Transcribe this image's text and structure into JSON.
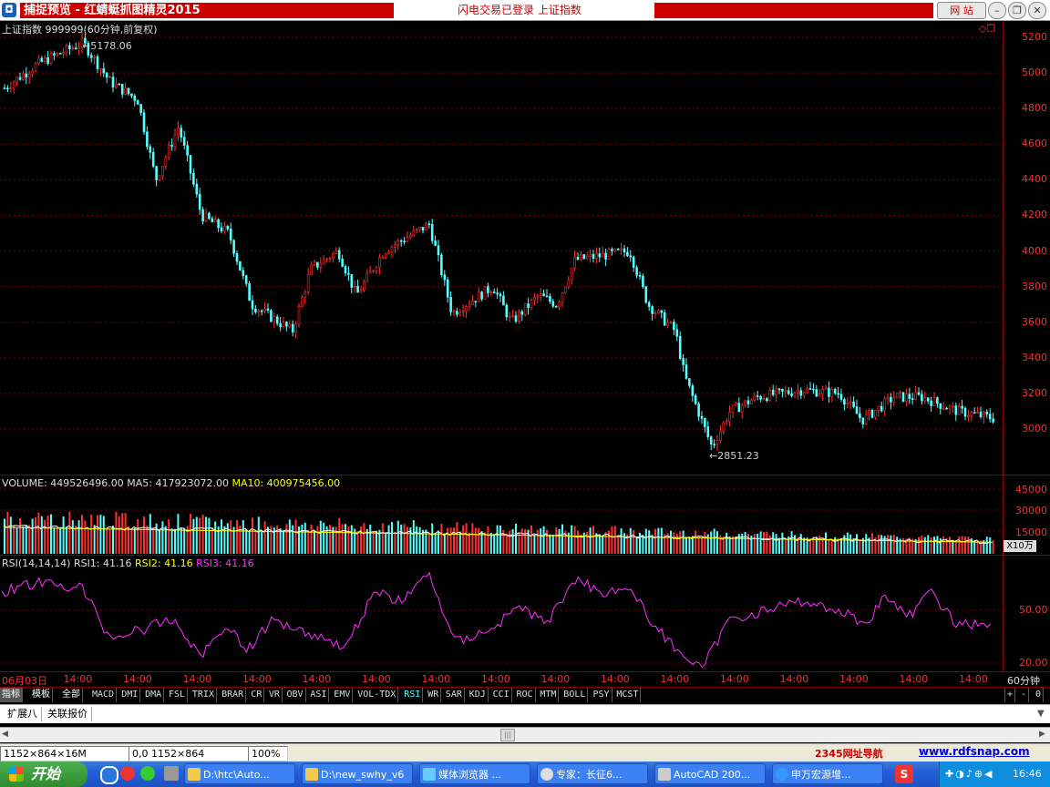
{
  "titlebar": {
    "app_title": "捕捉预览 - 红蜻蜓抓图精灵2015",
    "status_text": "闪电交易已登录   上证指数",
    "website_button": "网 站"
  },
  "main_chart": {
    "header": "上证指数 999999(60分钟,前复权)",
    "high_label": "5178.06",
    "low_label": "2851.23",
    "y_ticks": [
      "5200",
      "5000",
      "4800",
      "4600",
      "4400",
      "4200",
      "4000",
      "3800",
      "3600",
      "3400",
      "3200",
      "3000"
    ]
  },
  "volume_panel": {
    "label": "VOLUME: 449526496.00",
    "ma5_label": "MA5: 417923072.00",
    "ma10_label": "MA10: 400975456.00",
    "y_ticks": [
      "45000",
      "30000",
      "15000"
    ],
    "unit": "X10万"
  },
  "rsi_panel": {
    "label": "RSI(14,14,14)",
    "rsi1": "RSI1: 41.16",
    "rsi2": "RSI2: 41.16",
    "rsi3": "RSI3: 41.16",
    "y_ticks": [
      "50.00",
      "20.00"
    ]
  },
  "time_axis": {
    "labels": [
      "06月03日",
      "14:00",
      "14:00",
      "14:00",
      "14:00",
      "14:00",
      "14:00",
      "14:00",
      "14:00",
      "14:00",
      "14:00",
      "14:00",
      "14:00",
      "14:00",
      "14:00",
      "14:00",
      "14:00"
    ],
    "period": "60分钟"
  },
  "indicator_tabs": [
    "指标",
    "模板",
    "全部",
    "MACD",
    "DMI",
    "DMA",
    "FSL",
    "TRIX",
    "BRAR",
    "CR",
    "VR",
    "OBV",
    "ASI",
    "EMV",
    "VOL-TDX",
    "RSI",
    "WR",
    "SAR",
    "KDJ",
    "CCI",
    "ROC",
    "MTM",
    "BOLL",
    "PSY",
    "MCST"
  ],
  "active_indicator": "RSI",
  "zoom_buttons": [
    "+",
    "-",
    "0"
  ],
  "ext_tabs": [
    "扩展八",
    "关联报价"
  ],
  "statusbar": {
    "size": "1152×864×16M",
    "coords": "0,0 1152×864",
    "zoom": "100%",
    "nav_link": "2345网址导航",
    "site_link": "www.rdfsnap.com"
  },
  "taskbar": {
    "start": "开始",
    "tasks": [
      "D:\\htc\\Auto...",
      "D:\\new_swhy_v6",
      "媒体浏览器 ...",
      "专家：长征6...",
      "AutoCAD 200...",
      "申万宏源增..."
    ],
    "clock": "16:46"
  },
  "colors": {
    "up": "#ff3030",
    "down": "#54ffff",
    "grid": "#800000",
    "ma5": "#ffffff",
    "ma10": "#ffff00",
    "rsi": "#ff30ff"
  }
}
